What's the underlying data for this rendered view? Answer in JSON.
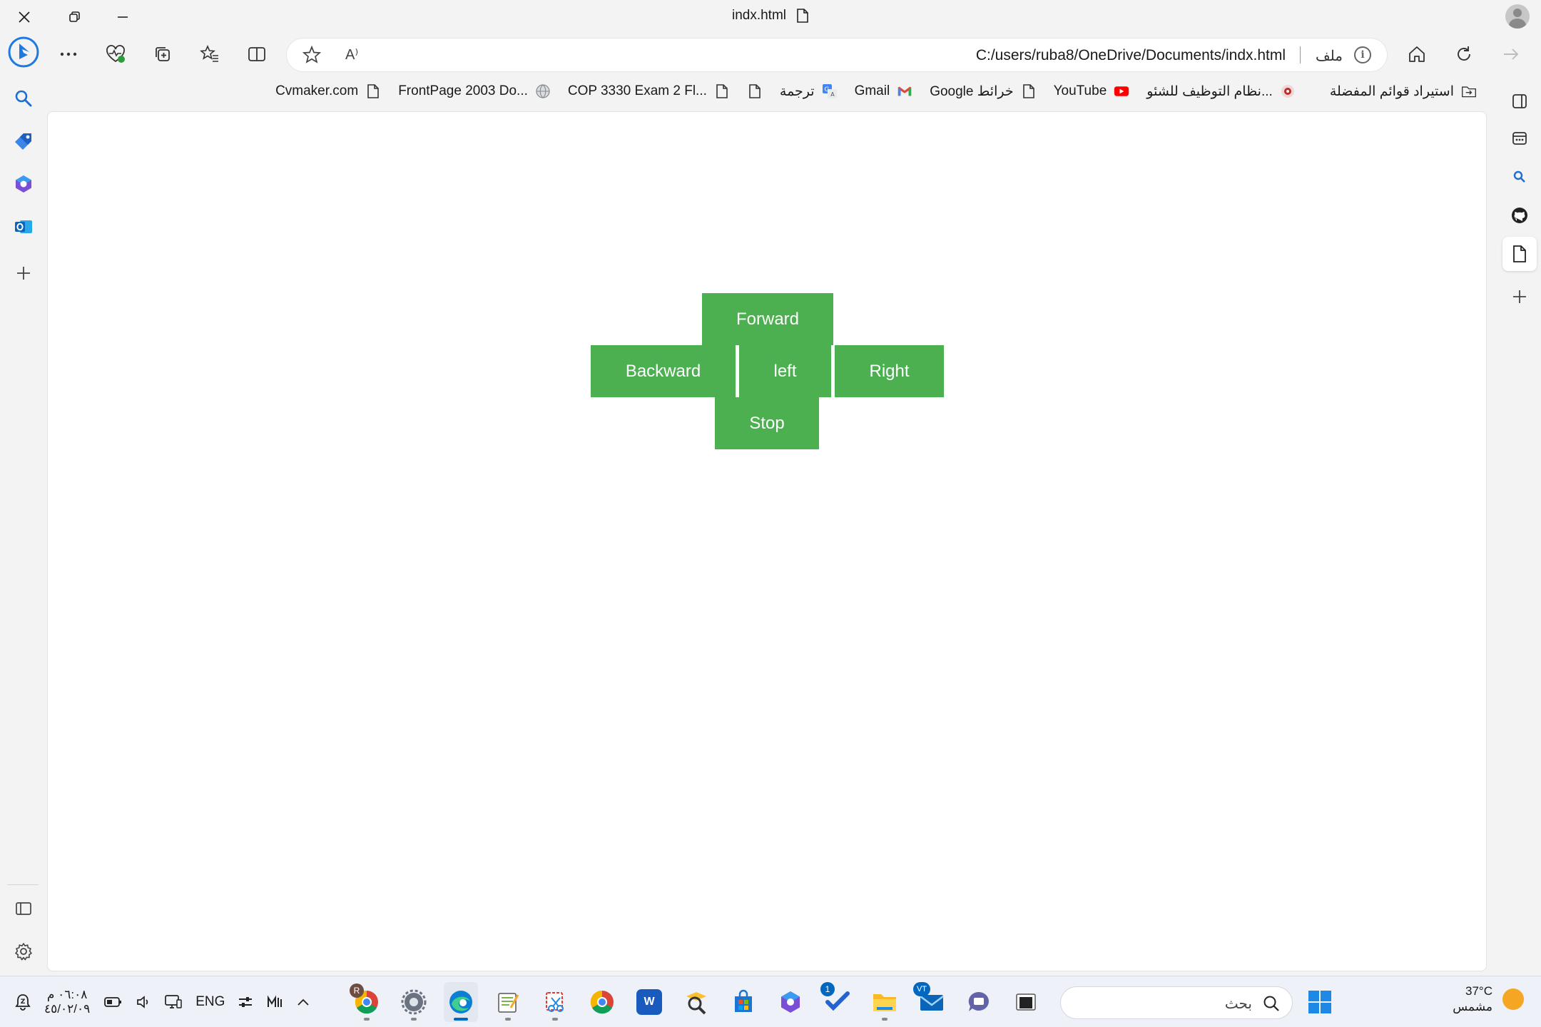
{
  "window": {
    "title": "indx.html"
  },
  "toolbar": {
    "url": "C:/users/ruba8/OneDrive/Documents/indx.html",
    "scheme_label": "ملف",
    "info_glyph": "i",
    "read_aloud_glyph": "A⁾"
  },
  "favorites": [
    {
      "label": "استيراد قوائم المفضلة",
      "icon": "import-folder-icon"
    },
    {
      "label": "نظام التوظيف للشئو...",
      "icon": "site-icon"
    },
    {
      "label": "YouTube",
      "icon": "youtube-icon"
    },
    {
      "label": "Google خرائط",
      "icon": "page-icon"
    },
    {
      "label": "Gmail",
      "icon": "gmail-icon"
    },
    {
      "label": "ترجمة",
      "icon": "translate-icon"
    },
    {
      "label": "",
      "icon": "page-icon"
    },
    {
      "label": "COP 3330 Exam 2 Fl...",
      "icon": "page-icon"
    },
    {
      "label": "FrontPage 2003 Do...",
      "icon": "globe-icon"
    },
    {
      "label": "Cvmaker.com",
      "icon": "page-icon"
    }
  ],
  "controls": {
    "forward": "Forward",
    "backward": "Backward",
    "left": "left",
    "right": "Right",
    "stop": "Stop",
    "color": "#4caf50"
  },
  "taskbar": {
    "time": "٠٦:٠٨ م",
    "date": "٤٥/٠٢/٠٩",
    "language": "ENG",
    "search_placeholder": "بحث",
    "weather_temp": "37°C",
    "weather_desc": "مشمس",
    "badge_chrome": "R",
    "badge_todo": "1",
    "badge_mail": "VT",
    "accent": "#0067c0"
  }
}
